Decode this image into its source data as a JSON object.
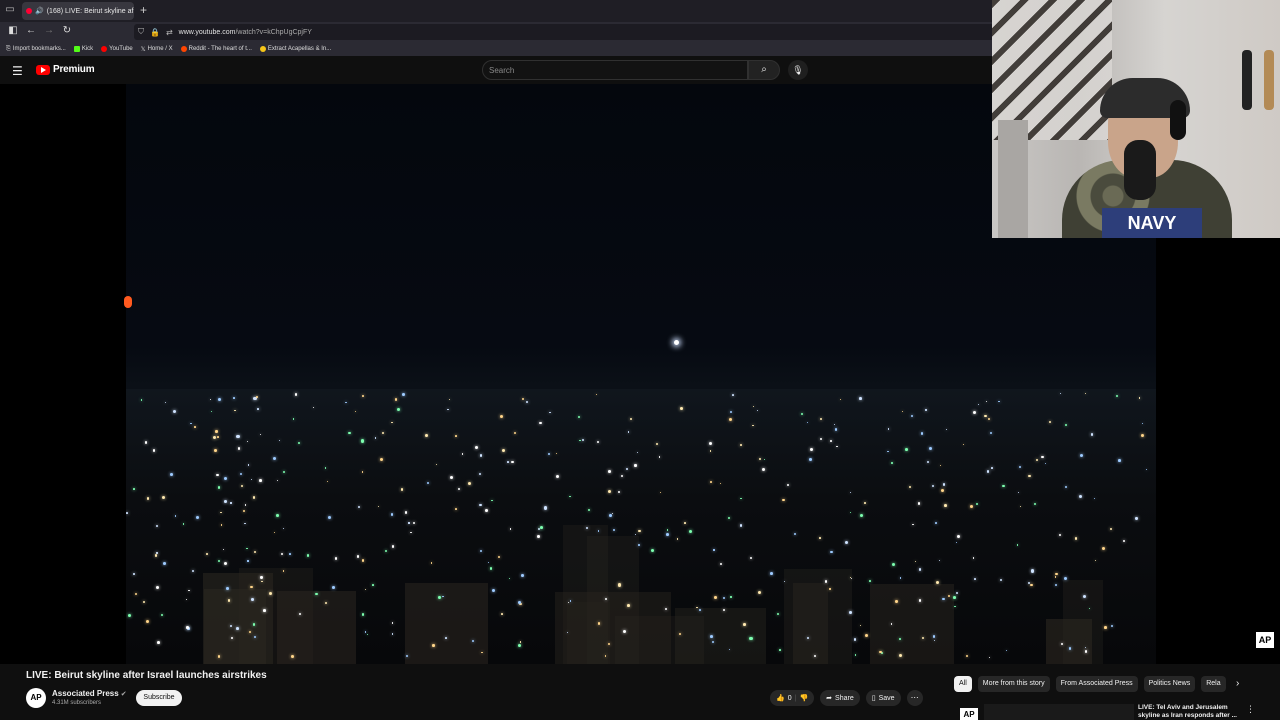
{
  "browser": {
    "tab_title": "(168) LIVE: Beirut skyline af",
    "url_host": "www.youtube.com",
    "url_path": "/watch?v=kChpUgCpjFY",
    "bookmarks": [
      "Import bookmarks...",
      "Kick",
      "YouTube",
      "Home / X",
      "Reddit - The heart of t...",
      "Extract Acapellas & In..."
    ]
  },
  "header": {
    "logo_text": "Premium",
    "search_placeholder": "Search"
  },
  "video": {
    "title": "LIVE: Beirut skyline after Israel launches airstrikes",
    "watermark": "AP"
  },
  "channel": {
    "avatar_text": "AP",
    "name": "Associated Press",
    "subscribers": "4.31M subscribers",
    "subscribe_label": "Subscribe"
  },
  "actions": {
    "like_count": "0",
    "share_label": "Share",
    "save_label": "Save"
  },
  "chips": [
    "All",
    "More from this story",
    "From Associated Press",
    "Politics News",
    "Rela"
  ],
  "recommendation": {
    "channel_logo": "AP",
    "title": "LIVE: Tel Aviv and Jerusalem skyline as Iran responds after ..."
  },
  "webcam": {
    "shirt_text": "NAVY"
  },
  "colors": {
    "accent": "#ff0000",
    "background": "#0f0f0f"
  }
}
